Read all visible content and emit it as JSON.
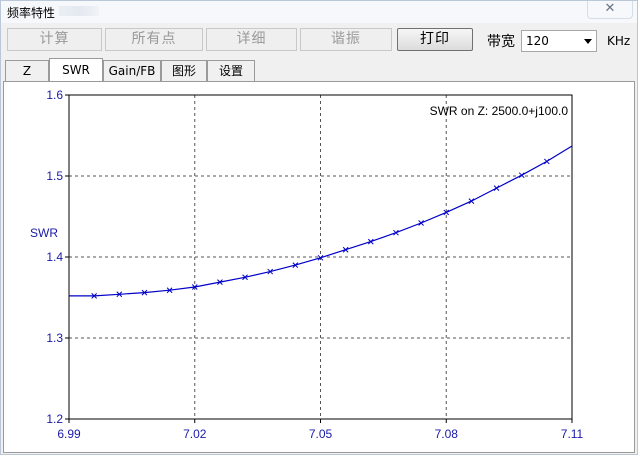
{
  "window": {
    "title": "频率特性",
    "close_glyph": "✕"
  },
  "toolbar": {
    "buttons": [
      {
        "label": "计算",
        "enabled": false
      },
      {
        "label": "所有点",
        "enabled": false
      },
      {
        "label": "详细",
        "enabled": false
      },
      {
        "label": "谐振",
        "enabled": false
      },
      {
        "label": "打印",
        "enabled": true
      }
    ],
    "bandwidth_label": "带宽",
    "bandwidth_value": "120",
    "bandwidth_unit": "KHz"
  },
  "tabs": [
    {
      "label": "Z",
      "active": false
    },
    {
      "label": "SWR",
      "active": true
    },
    {
      "label": "Gain/FB",
      "active": false
    },
    {
      "label": "图形",
      "active": false
    },
    {
      "label": "设置",
      "active": false
    }
  ],
  "chart_data": {
    "type": "line",
    "title": "SWR on Z: 2500.0+j100.0",
    "xlabel": "",
    "ylabel": "SWR",
    "xlim": [
      6.99,
      7.11
    ],
    "ylim": [
      1.2,
      1.6
    ],
    "x_ticks": [
      "6.99",
      "7.02",
      "7.05",
      "7.08",
      "7.11"
    ],
    "y_ticks": [
      "1.2",
      "1.3",
      "1.4",
      "1.5",
      "1.6"
    ],
    "grid": true,
    "line_color": "#0000c8",
    "axis_label_color": "#1a1aa8",
    "series": [
      {
        "x": [
          6.99,
          6.996,
          7.002,
          7.008,
          7.014,
          7.02,
          7.026,
          7.032,
          7.038,
          7.044,
          7.05,
          7.056,
          7.062,
          7.068,
          7.074,
          7.08,
          7.086,
          7.092,
          7.098,
          7.104,
          7.11
        ],
        "values": [
          1.352,
          1.352,
          1.354,
          1.356,
          1.359,
          1.363,
          1.369,
          1.375,
          1.382,
          1.39,
          1.399,
          1.409,
          1.419,
          1.43,
          1.442,
          1.455,
          1.469,
          1.485,
          1.501,
          1.518,
          1.537
        ]
      }
    ]
  }
}
